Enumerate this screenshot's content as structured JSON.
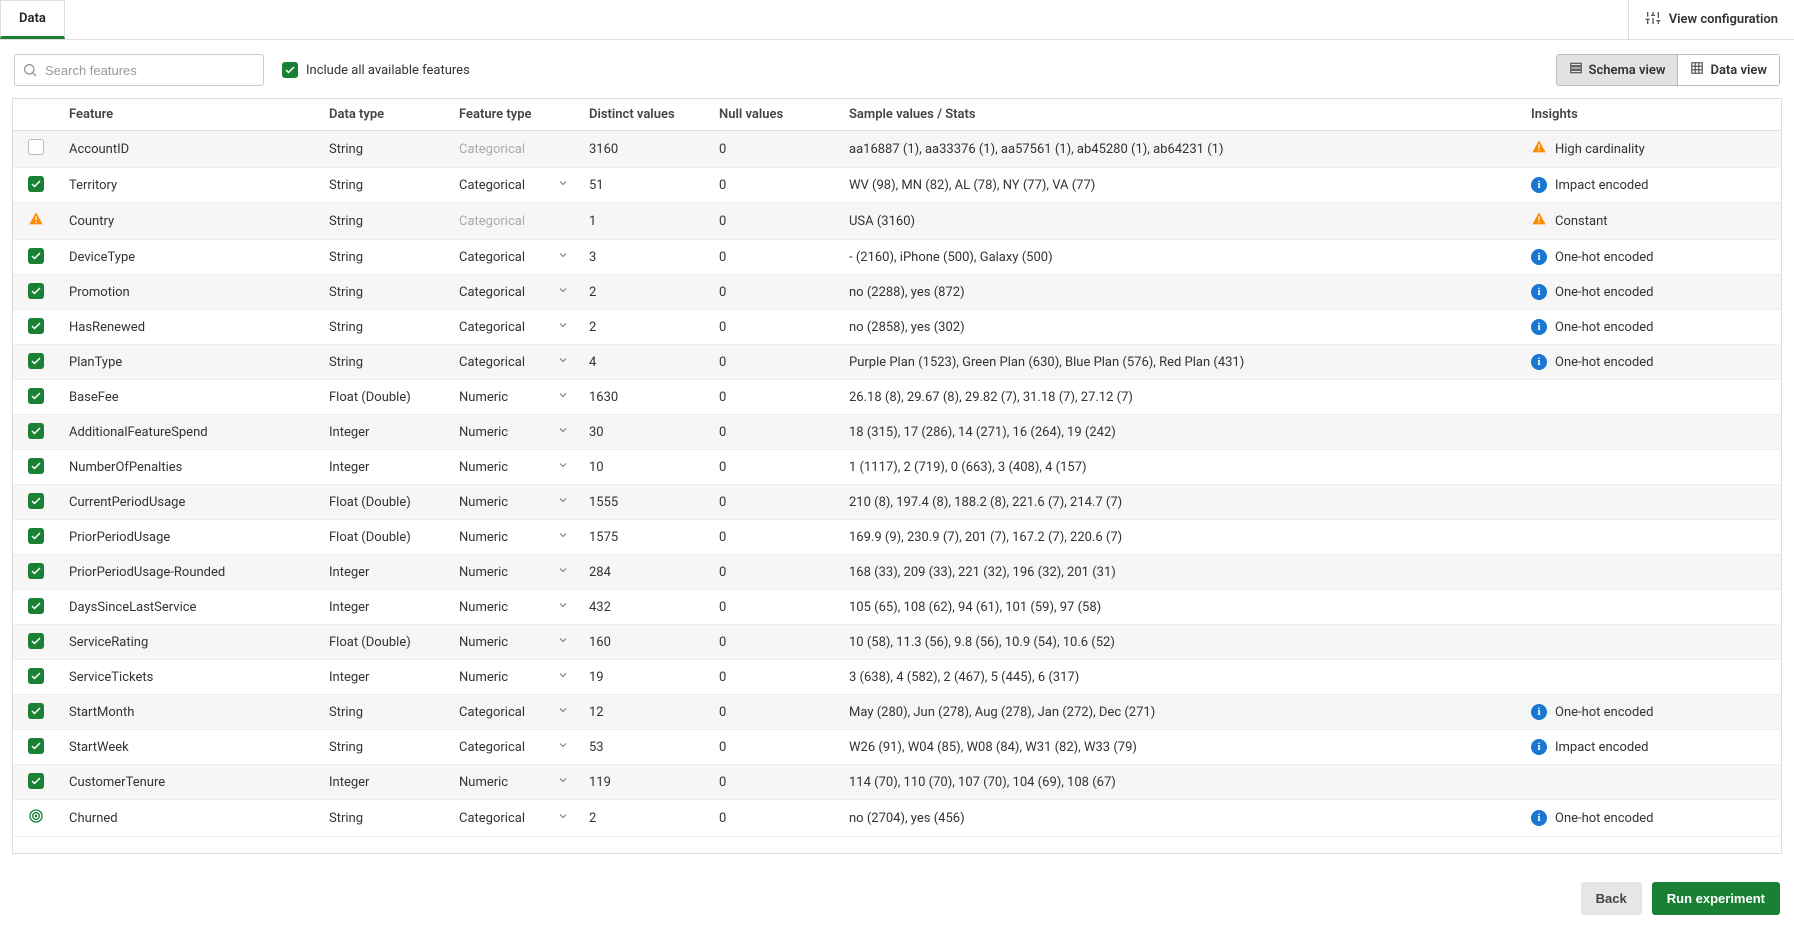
{
  "tab": "Data",
  "viewConfiguration": "View configuration",
  "search": {
    "placeholder": "Search features"
  },
  "includeAll": "Include all available features",
  "viewToggle": {
    "schema": "Schema view",
    "data": "Data view"
  },
  "columns": {
    "feature": "Feature",
    "dataType": "Data type",
    "featureType": "Feature type",
    "distinct": "Distinct values",
    "nulls": "Null values",
    "sample": "Sample values / Stats",
    "insights": "Insights"
  },
  "buttons": {
    "back": "Back",
    "run": "Run experiment"
  },
  "rows": [
    {
      "sel": "off",
      "feature": "AccountID",
      "dtype": "String",
      "ftype": "Categorical",
      "ftMuted": true,
      "chev": false,
      "distinct": "3160",
      "nulls": "0",
      "sample": "aa16887 (1), aa33376 (1), aa57561 (1), ab45280 (1), ab64231 (1)",
      "insightIcon": "warn",
      "insight": "High cardinality"
    },
    {
      "sel": "on",
      "feature": "Territory",
      "dtype": "String",
      "ftype": "Categorical",
      "ftMuted": false,
      "chev": true,
      "distinct": "51",
      "nulls": "0",
      "sample": "WV (98), MN (82), AL (78), NY (77), VA (77)",
      "insightIcon": "info",
      "insight": "Impact encoded"
    },
    {
      "sel": "warn",
      "feature": "Country",
      "dtype": "String",
      "ftype": "Categorical",
      "ftMuted": true,
      "chev": false,
      "distinct": "1",
      "nulls": "0",
      "sample": "USA (3160)",
      "insightIcon": "warn",
      "insight": "Constant"
    },
    {
      "sel": "on",
      "feature": "DeviceType",
      "dtype": "String",
      "ftype": "Categorical",
      "ftMuted": false,
      "chev": true,
      "distinct": "3",
      "nulls": "0",
      "sample": "- (2160), iPhone (500), Galaxy (500)",
      "insightIcon": "info",
      "insight": "One-hot encoded"
    },
    {
      "sel": "on",
      "feature": "Promotion",
      "dtype": "String",
      "ftype": "Categorical",
      "ftMuted": false,
      "chev": true,
      "distinct": "2",
      "nulls": "0",
      "sample": "no (2288), yes (872)",
      "insightIcon": "info",
      "insight": "One-hot encoded"
    },
    {
      "sel": "on",
      "feature": "HasRenewed",
      "dtype": "String",
      "ftype": "Categorical",
      "ftMuted": false,
      "chev": true,
      "distinct": "2",
      "nulls": "0",
      "sample": "no (2858), yes (302)",
      "insightIcon": "info",
      "insight": "One-hot encoded"
    },
    {
      "sel": "on",
      "feature": "PlanType",
      "dtype": "String",
      "ftype": "Categorical",
      "ftMuted": false,
      "chev": true,
      "distinct": "4",
      "nulls": "0",
      "sample": "Purple Plan (1523), Green Plan (630), Blue Plan (576), Red Plan (431)",
      "insightIcon": "info",
      "insight": "One-hot encoded"
    },
    {
      "sel": "on",
      "feature": "BaseFee",
      "dtype": "Float (Double)",
      "ftype": "Numeric",
      "ftMuted": false,
      "chev": true,
      "distinct": "1630",
      "nulls": "0",
      "sample": "26.18 (8), 29.67 (8), 29.82 (7), 31.18 (7), 27.12 (7)",
      "insightIcon": "",
      "insight": ""
    },
    {
      "sel": "on",
      "feature": "AdditionalFeatureSpend",
      "dtype": "Integer",
      "ftype": "Numeric",
      "ftMuted": false,
      "chev": true,
      "distinct": "30",
      "nulls": "0",
      "sample": "18 (315), 17 (286), 14 (271), 16 (264), 19 (242)",
      "insightIcon": "",
      "insight": ""
    },
    {
      "sel": "on",
      "feature": "NumberOfPenalties",
      "dtype": "Integer",
      "ftype": "Numeric",
      "ftMuted": false,
      "chev": true,
      "distinct": "10",
      "nulls": "0",
      "sample": "1 (1117), 2 (719), 0 (663), 3 (408), 4 (157)",
      "insightIcon": "",
      "insight": ""
    },
    {
      "sel": "on",
      "feature": "CurrentPeriodUsage",
      "dtype": "Float (Double)",
      "ftype": "Numeric",
      "ftMuted": false,
      "chev": true,
      "distinct": "1555",
      "nulls": "0",
      "sample": "210 (8), 197.4 (8), 188.2 (8), 221.6 (7), 214.7 (7)",
      "insightIcon": "",
      "insight": ""
    },
    {
      "sel": "on",
      "feature": "PriorPeriodUsage",
      "dtype": "Float (Double)",
      "ftype": "Numeric",
      "ftMuted": false,
      "chev": true,
      "distinct": "1575",
      "nulls": "0",
      "sample": "169.9 (9), 230.9 (7), 201 (7), 167.2 (7), 220.6 (7)",
      "insightIcon": "",
      "insight": ""
    },
    {
      "sel": "on",
      "feature": "PriorPeriodUsage-Rounded",
      "dtype": "Integer",
      "ftype": "Numeric",
      "ftMuted": false,
      "chev": true,
      "distinct": "284",
      "nulls": "0",
      "sample": "168 (33), 209 (33), 221 (32), 196 (32), 201 (31)",
      "insightIcon": "",
      "insight": ""
    },
    {
      "sel": "on",
      "feature": "DaysSinceLastService",
      "dtype": "Integer",
      "ftype": "Numeric",
      "ftMuted": false,
      "chev": true,
      "distinct": "432",
      "nulls": "0",
      "sample": "105 (65), 108 (62), 94 (61), 101 (59), 97 (58)",
      "insightIcon": "",
      "insight": ""
    },
    {
      "sel": "on",
      "feature": "ServiceRating",
      "dtype": "Float (Double)",
      "ftype": "Numeric",
      "ftMuted": false,
      "chev": true,
      "distinct": "160",
      "nulls": "0",
      "sample": "10 (58), 11.3 (56), 9.8 (56), 10.9 (54), 10.6 (52)",
      "insightIcon": "",
      "insight": ""
    },
    {
      "sel": "on",
      "feature": "ServiceTickets",
      "dtype": "Integer",
      "ftype": "Numeric",
      "ftMuted": false,
      "chev": true,
      "distinct": "19",
      "nulls": "0",
      "sample": "3 (638), 4 (582), 2 (467), 5 (445), 6 (317)",
      "insightIcon": "",
      "insight": ""
    },
    {
      "sel": "on",
      "feature": "StartMonth",
      "dtype": "String",
      "ftype": "Categorical",
      "ftMuted": false,
      "chev": true,
      "distinct": "12",
      "nulls": "0",
      "sample": "May (280), Jun (278), Aug (278), Jan (272), Dec (271)",
      "insightIcon": "info",
      "insight": "One-hot encoded"
    },
    {
      "sel": "on",
      "feature": "StartWeek",
      "dtype": "String",
      "ftype": "Categorical",
      "ftMuted": false,
      "chev": true,
      "distinct": "53",
      "nulls": "0",
      "sample": "W26 (91), W04 (85), W08 (84), W31 (82), W33 (79)",
      "insightIcon": "info",
      "insight": "Impact encoded"
    },
    {
      "sel": "on",
      "feature": "CustomerTenure",
      "dtype": "Integer",
      "ftype": "Numeric",
      "ftMuted": false,
      "chev": true,
      "distinct": "119",
      "nulls": "0",
      "sample": "114 (70), 110 (70), 107 (70), 104 (69), 108 (67)",
      "insightIcon": "",
      "insight": ""
    },
    {
      "sel": "target",
      "feature": "Churned",
      "dtype": "String",
      "ftype": "Categorical",
      "ftMuted": false,
      "chev": true,
      "distinct": "2",
      "nulls": "0",
      "sample": "no (2704), yes (456)",
      "insightIcon": "info",
      "insight": "One-hot encoded"
    }
  ]
}
